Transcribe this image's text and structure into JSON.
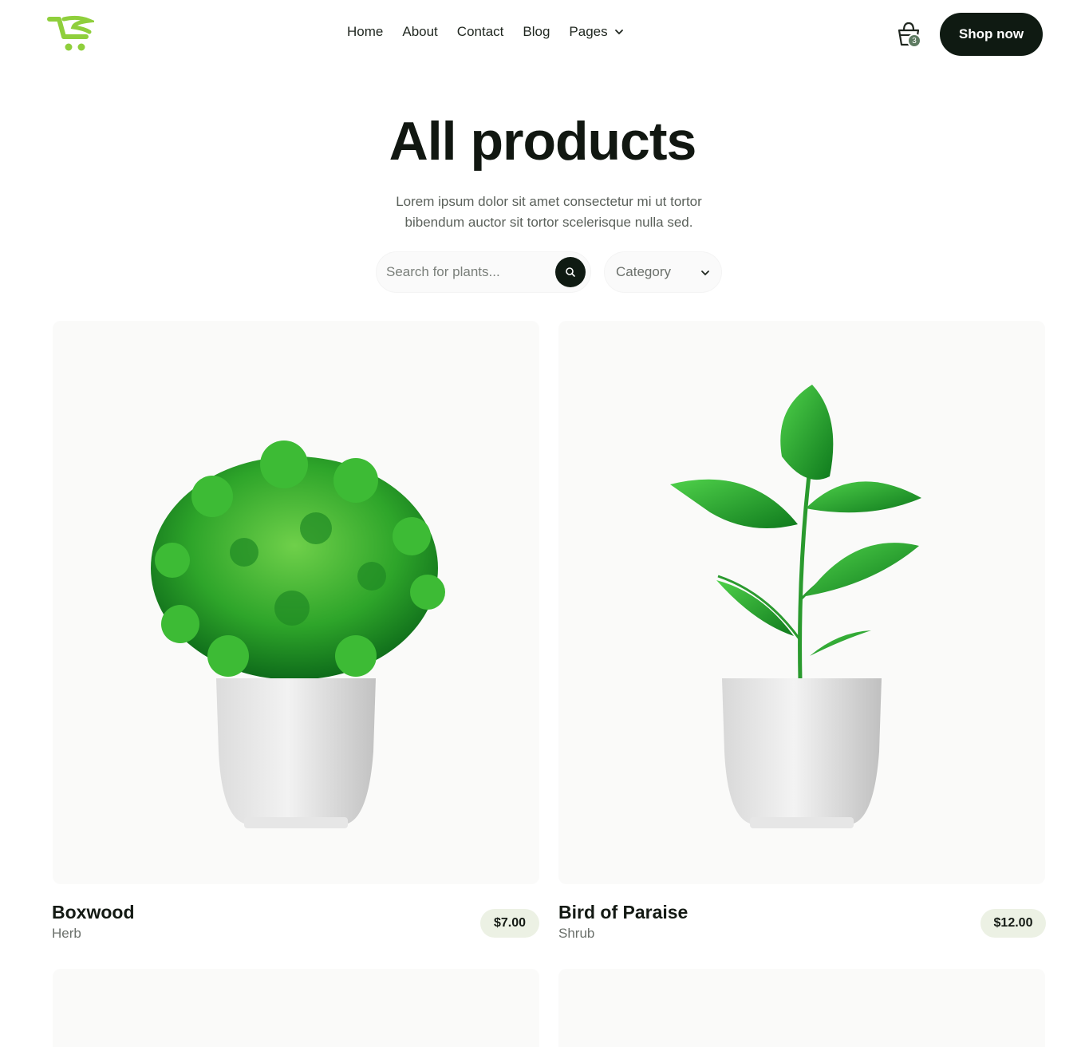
{
  "header": {
    "logo_icon": "cart-logo-icon",
    "nav": [
      {
        "label": "Home"
      },
      {
        "label": "About"
      },
      {
        "label": "Contact"
      },
      {
        "label": "Blog"
      },
      {
        "label": "Pages",
        "has_dropdown": true
      }
    ],
    "cart": {
      "icon": "shopping-bag-icon",
      "count": "3"
    },
    "cta_label": "Shop now"
  },
  "hero": {
    "title": "All products",
    "subtitle_line1": "Lorem ipsum dolor sit amet consectetur mi ut tortor",
    "subtitle_line2": "bibendum auctor sit tortor scelerisque nulla sed."
  },
  "filters": {
    "search_placeholder": "Search for plants...",
    "search_value": "",
    "category_label": "Category"
  },
  "products": [
    {
      "name": "Boxwood",
      "category": "Herb",
      "price": "$7.00"
    },
    {
      "name": "Bird of Paraise",
      "category": "Shrub",
      "price": "$12.00"
    }
  ],
  "colors": {
    "accent_logo": "#8fcf3c",
    "dark": "#0f1a12",
    "price_bg": "#ecf1e4",
    "badge": "#5d7a61"
  }
}
